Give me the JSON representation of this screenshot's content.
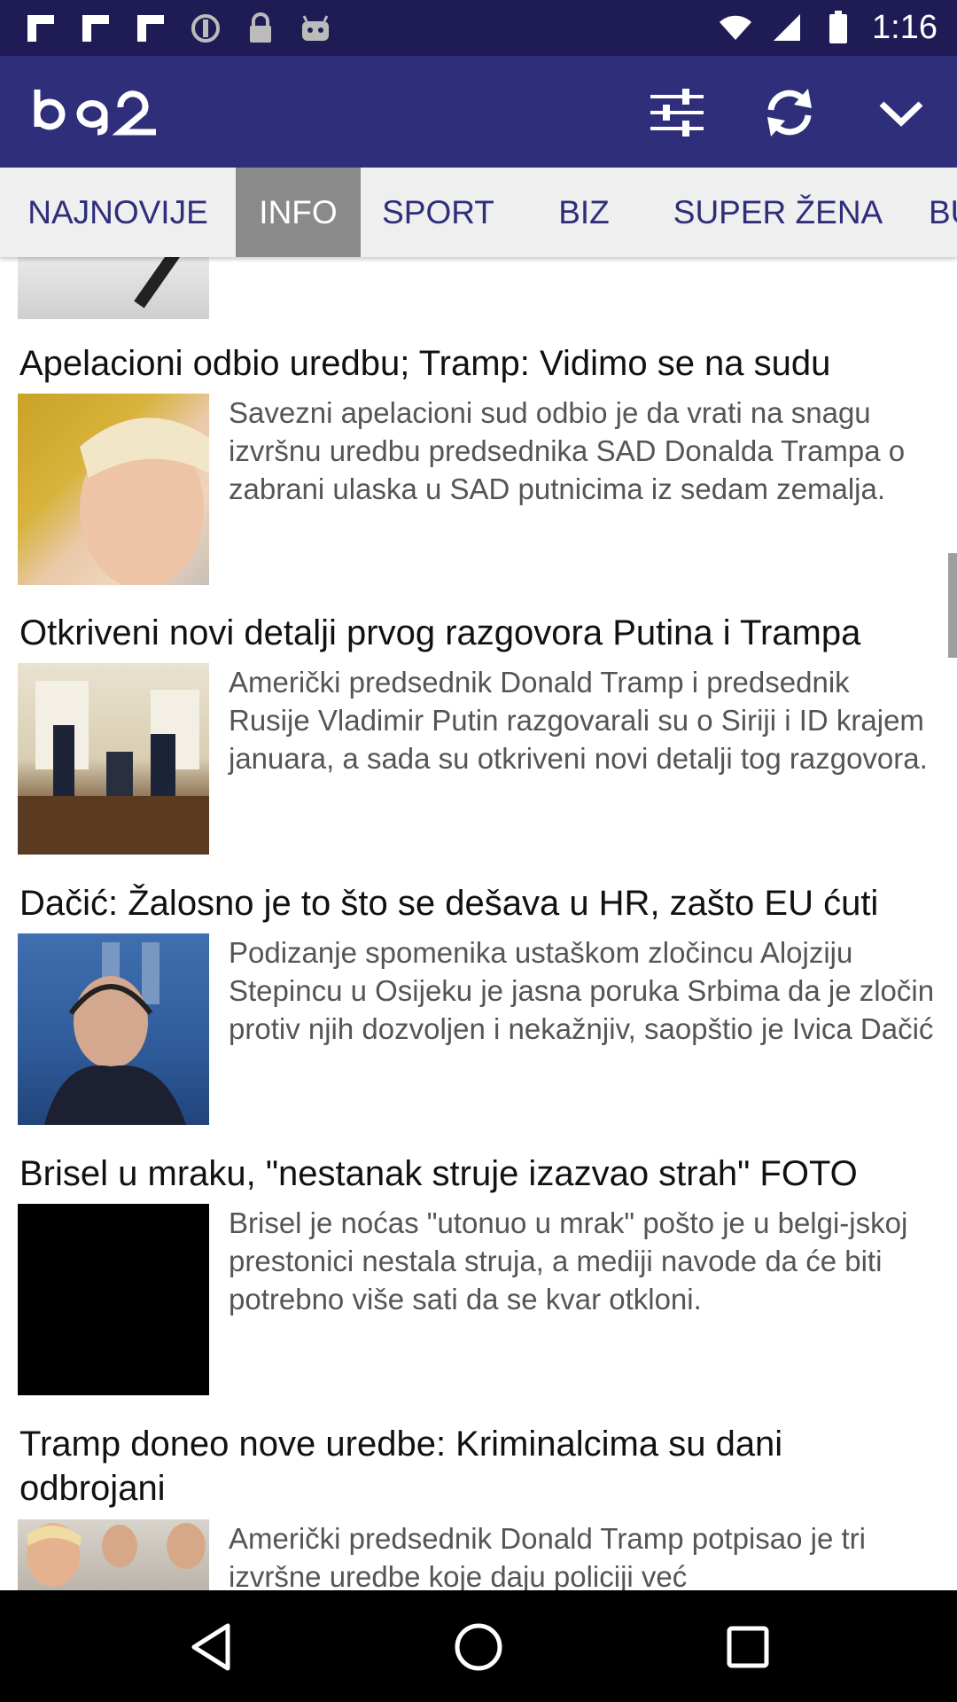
{
  "status_bar": {
    "time": "1:16",
    "left_icons": [
      "flipboard-icon",
      "flipboard-icon",
      "flipboard-icon",
      "do-not-disturb-icon",
      "lock-icon",
      "android-icon"
    ]
  },
  "app_bar": {
    "logo_text": "b92",
    "actions": [
      "filter-sliders-icon",
      "refresh-icon",
      "chevron-down-icon"
    ]
  },
  "tabs": [
    {
      "label": "NAJNOVIJE",
      "active": false
    },
    {
      "label": "INFO",
      "active": true
    },
    {
      "label": "SPORT",
      "active": false
    },
    {
      "label": "BIZ",
      "active": false
    },
    {
      "label": "SUPER ŽENA",
      "active": false
    },
    {
      "label": "BU",
      "active": false
    }
  ],
  "articles": [
    {
      "headline": "Apelacioni odbio uredbu; Tramp: Vidimo se na sudu",
      "summary": "Savezni apelacioni sud odbio je da vrati na snagu izvršnu uredbu predsednika SAD Donalda Trampa o zabrani ulaska u SAD putnicima iz sedam zemalja."
    },
    {
      "headline": "Otkriveni novi detalji prvog razgovora Putina i Trampa",
      "summary": "Američki predsednik Donald Tramp i predsednik Rusije Vladimir Putin razgovarali su o Siriji i ID krajem januara, a sada su otkriveni novi detalji tog razgovora."
    },
    {
      "headline": "Dačić: Žalosno je to što se dešava u HR, zašto EU ćuti",
      "summary": "Podizanje spomenika ustaškom zločincu Alojziju Stepincu u Osijeku je jasna poruka Srbima da je zločin protiv njih dozvoljen i nekažnjiv, saopštio je Ivica Dačić"
    },
    {
      "headline": "Brisel u mraku, \"nestanak struje izazvao strah\" FOTO",
      "summary": "Brisel je noćas \"utonuo u mrak\" pošto je u belgi-jskoj prestonici nestala struja, a mediji navode da će biti potrebno više sati da se kvar otkloni."
    },
    {
      "headline": "Tramp doneo nove uredbe: Kriminalcima su dani odbrojani",
      "summary": "Američki predsednik Donald Tramp potpisao je tri izvršne uredbe koje daju policiji već"
    }
  ],
  "colors": {
    "status_bar": "#1f1b54",
    "app_bar": "#2e2e7a",
    "tab_text": "#2e2e7a",
    "tab_active_bg": "#8a8a8a",
    "tabs_bg": "#efefef"
  },
  "nav_bar": [
    "back-icon",
    "home-icon",
    "recents-icon"
  ]
}
